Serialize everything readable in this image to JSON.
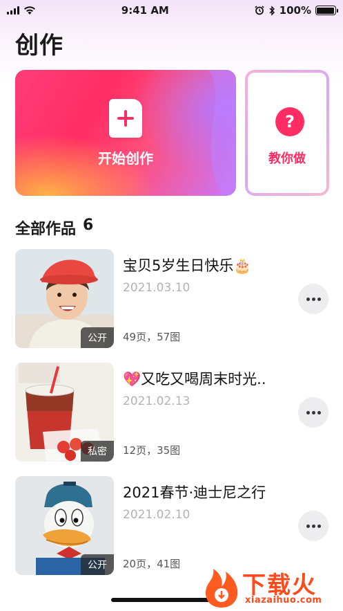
{
  "status_bar": {
    "time": "9:41 AM",
    "battery_percent": "100%"
  },
  "page": {
    "title": "创作"
  },
  "create_card": {
    "label": "开始创作"
  },
  "help_card": {
    "icon_char": "?",
    "label": "教你做"
  },
  "section": {
    "title": "全部作品",
    "count": "6"
  },
  "works": [
    {
      "title": "宝贝5岁生日快乐🎂",
      "date": "2021.03.10",
      "meta": "49页，57图",
      "badge": "公开"
    },
    {
      "title": "💖又吃又喝周末时光..",
      "date": "2021.02.13",
      "meta": "12页，35图",
      "badge": "私密"
    },
    {
      "title": "2021春节·迪士尼之行",
      "date": "2021.02.10",
      "meta": "20页，41图",
      "badge": "公开"
    }
  ],
  "watermark": {
    "text": "下载火",
    "domain": "xiazaihuo.com"
  },
  "colors": {
    "accent": "#ff2d64",
    "watermark": "#ff4a1c"
  }
}
